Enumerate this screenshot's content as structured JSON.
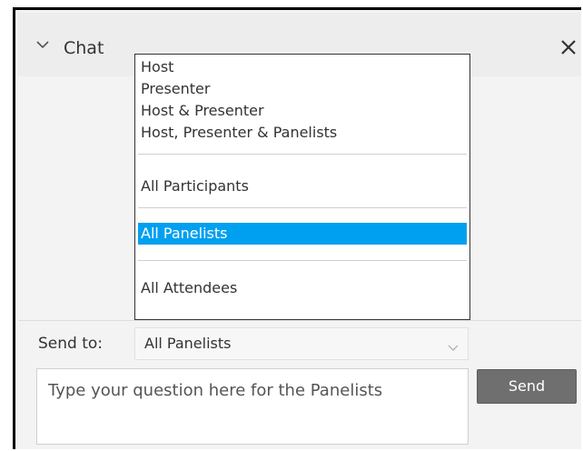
{
  "chat": {
    "title": "Chat",
    "collapse_icon": "chevron-down-icon",
    "close_icon": "close-icon"
  },
  "dropdown": {
    "options": [
      "Host",
      "Presenter",
      "Host & Presenter",
      "Host, Presenter & Panelists",
      "All Participants",
      "All Panelists",
      "All Attendees"
    ],
    "selected": "All Panelists",
    "highlight_color": "#00a0f0"
  },
  "send_to": {
    "label": "Send to:",
    "value": "All Panelists"
  },
  "question": {
    "placeholder": "Type your question here for the Panelists"
  },
  "send_button": {
    "label": "Send"
  }
}
